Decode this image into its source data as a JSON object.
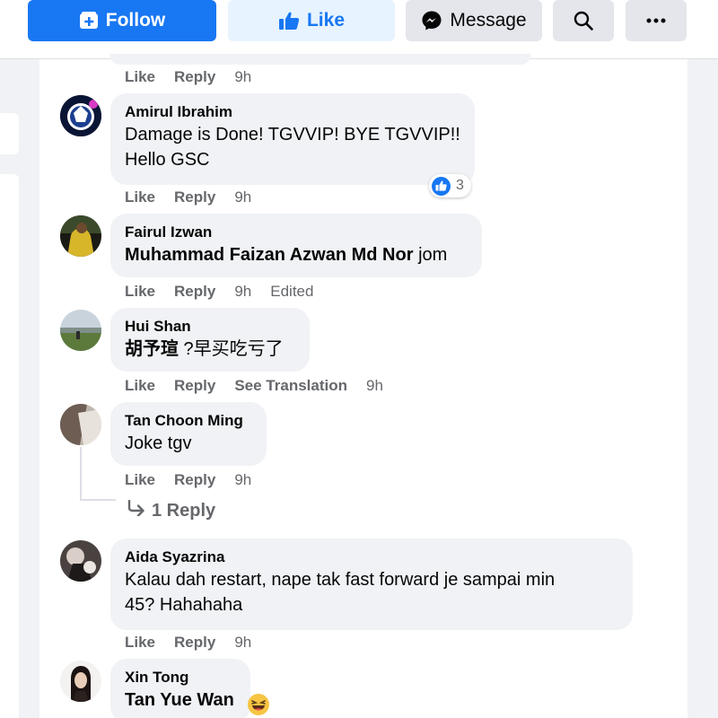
{
  "topbar": {
    "follow_label": "Follow",
    "like_label": "Like",
    "message_label": "Message"
  },
  "prev_comment": {
    "like": "Like",
    "reply": "Reply",
    "time": "9h"
  },
  "comments": [
    {
      "author": "Amirul Ibrahim",
      "line1": "Damage is Done! TGVVIP! BYE TGVVIP!!",
      "line2": "Hello GSC",
      "like": "Like",
      "reply": "Reply",
      "time": "9h",
      "reaction_count": "3"
    },
    {
      "author": "Fairul Izwan",
      "mention": "Muhammad Faizan Azwan Md Nor",
      "text": " jom",
      "like": "Like",
      "reply": "Reply",
      "time": "9h",
      "edited": "Edited"
    },
    {
      "author": "Hui Shan",
      "mention": "胡予瑄",
      "text": " ?早买吃亏了",
      "like": "Like",
      "reply": "Reply",
      "translation": "See Translation",
      "time": "9h"
    },
    {
      "author": "Tan Choon Ming",
      "text": "Joke tgv",
      "like": "Like",
      "reply": "Reply",
      "time": "9h",
      "replies_link": "1 Reply"
    },
    {
      "author": "Aida Syazrina",
      "line1": "Kalau dah restart, nape tak fast forward je sampai min",
      "line2": "45? Hahahaha",
      "like": "Like",
      "reply": "Reply",
      "time": "9h"
    },
    {
      "author": "Xin Tong",
      "mention": "Tan Yue Wan",
      "emoji": "laughing-emoji"
    }
  ],
  "colors": {
    "brand_blue": "#1877f2",
    "bubble_bg": "#f0f2f5",
    "meta_gray": "#65676b",
    "text": "#050505"
  }
}
